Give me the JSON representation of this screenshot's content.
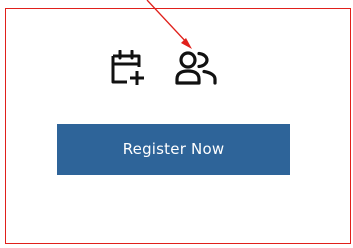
{
  "icons": {
    "calendar": "calendar-add-icon",
    "users": "users-icon"
  },
  "register_button": {
    "label": "Register Now",
    "color": "#2e6499",
    "text_color": "#ffffff"
  },
  "annotation": {
    "color": "#e0201b"
  }
}
